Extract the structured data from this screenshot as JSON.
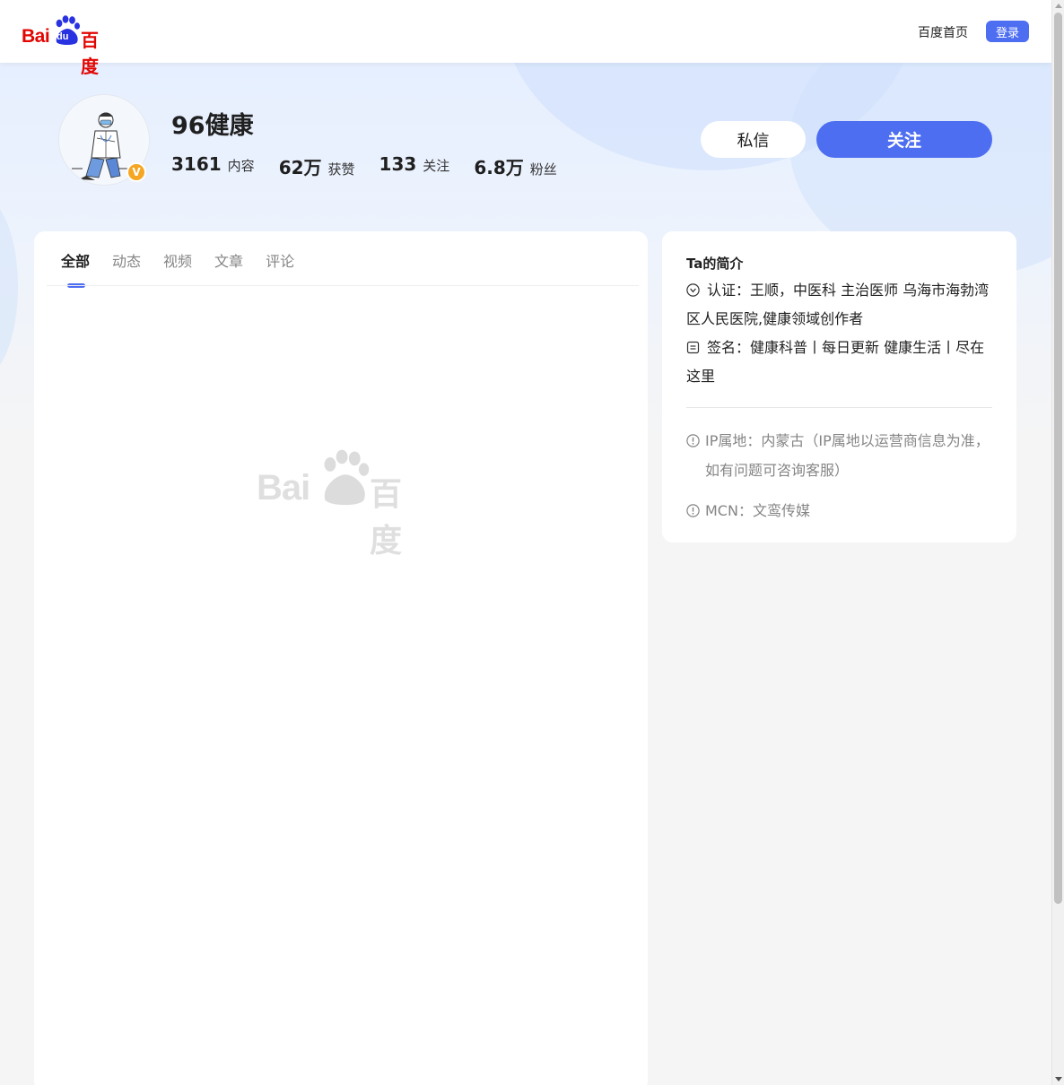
{
  "header": {
    "logo_text_latin": "Bai",
    "logo_text_du": "du",
    "logo_text_cn": "百度",
    "home_link": "百度首页",
    "login_label": "登录"
  },
  "profile": {
    "name": "96健康",
    "verified_badge": "V",
    "stats": [
      {
        "value": "3161",
        "label": "内容"
      },
      {
        "value": "62万",
        "label": "获赞"
      },
      {
        "value": "133",
        "label": "关注"
      },
      {
        "value": "6.8万",
        "label": "粉丝"
      }
    ],
    "message_label": "私信",
    "follow_label": "关注"
  },
  "tabs": [
    {
      "label": "全部",
      "active": true
    },
    {
      "label": "动态",
      "active": false
    },
    {
      "label": "视频",
      "active": false
    },
    {
      "label": "文章",
      "active": false
    },
    {
      "label": "评论",
      "active": false
    }
  ],
  "intro": {
    "title": "Ta的简介",
    "certification": "认证：王顺，中医科 主治医师 乌海市海勃湾区人民医院,健康领域创作者",
    "signature": "签名：健康科普丨每日更新 健康生活丨尽在这里",
    "ip_location": "IP属地：内蒙古（IP属地以运营商信息为准，如有问题可咨询客服）",
    "mcn": "MCN：文鸾传媒"
  },
  "colors": {
    "brand_blue": "#4e6ef2",
    "baidu_red": "#e10602",
    "badge_orange": "#f5a623"
  },
  "icons": {
    "certification": "verified-check-icon",
    "signature": "signature-doc-icon",
    "ip": "info-icon",
    "mcn": "info-icon"
  }
}
